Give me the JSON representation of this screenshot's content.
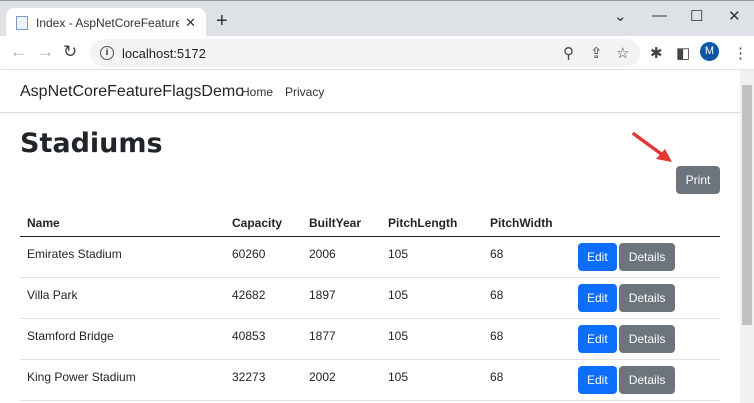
{
  "browser": {
    "tab_title": "Index - AspNetCoreFeatureFlagsDemo",
    "url": "localhost:5172",
    "avatar_letter": "M"
  },
  "navbar": {
    "brand": "AspNetCoreFeatureFlagsDemo",
    "links": [
      "Home",
      "Privacy"
    ]
  },
  "page": {
    "title": "Stadiums",
    "print_label": "Print",
    "annotation_color": "#e53935"
  },
  "table": {
    "headers": [
      "Name",
      "Capacity",
      "BuiltYear",
      "PitchLength",
      "PitchWidth"
    ],
    "rows": [
      [
        "Emirates Stadium",
        "60260",
        "2006",
        "105",
        "68"
      ],
      [
        "Villa Park",
        "42682",
        "1897",
        "105",
        "68"
      ],
      [
        "Stamford Bridge",
        "40853",
        "1877",
        "105",
        "68"
      ],
      [
        "King Power Stadium",
        "32273",
        "2002",
        "105",
        "68"
      ]
    ],
    "edit_label": "Edit",
    "details_label": "Details"
  }
}
